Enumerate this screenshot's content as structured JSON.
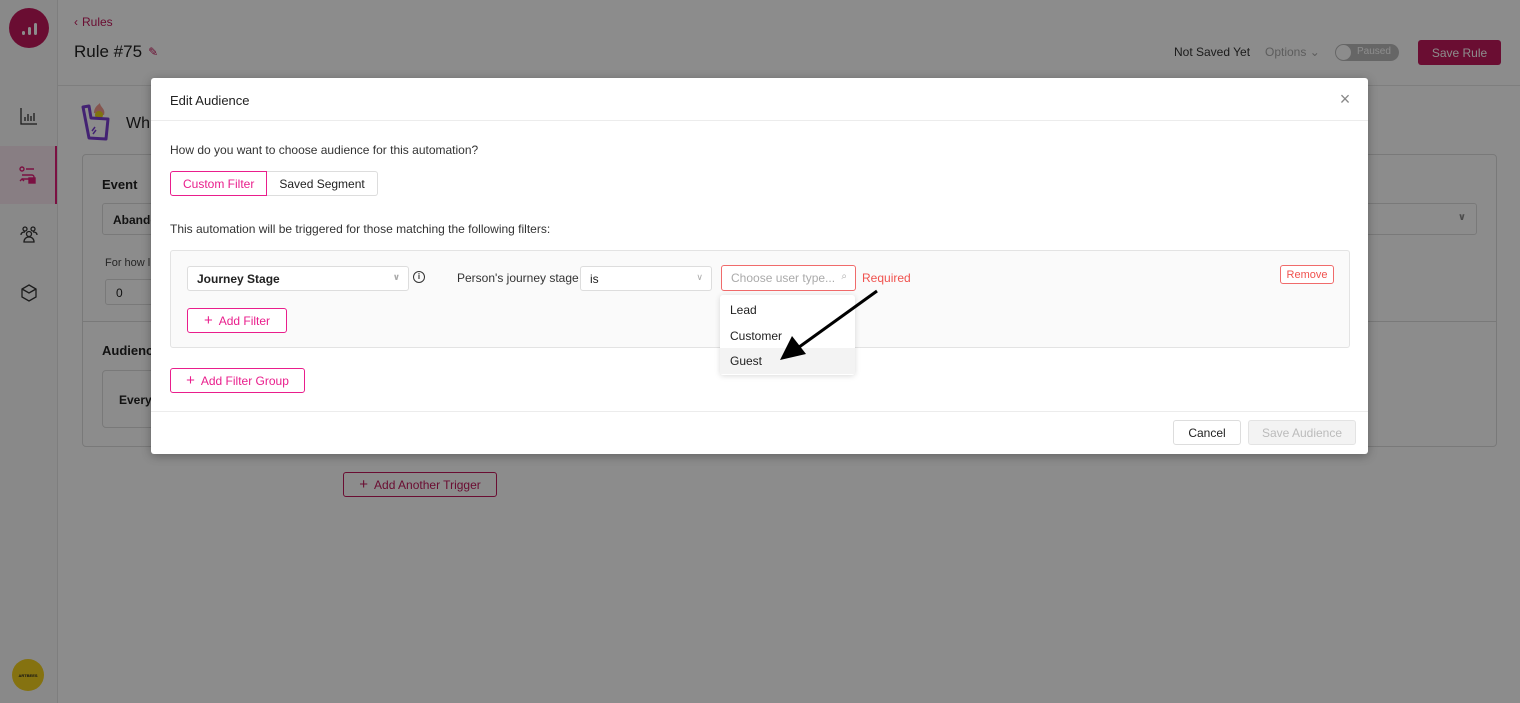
{
  "app": {
    "nav": [
      {
        "icon": "bar-chart-icon",
        "active": false
      },
      {
        "icon": "workflow-rules-icon",
        "active": true
      },
      {
        "icon": "users-icon",
        "active": false
      },
      {
        "icon": "cube-icon",
        "active": false
      }
    ],
    "brand_avatar_text": "ARTBEES"
  },
  "topbar": {
    "back_label": "Rules",
    "title": "Rule #75",
    "save_status": "Not Saved Yet",
    "options_label": "Options",
    "toggle_label": "Paused",
    "save_rule_label": "Save Rule"
  },
  "background": {
    "section_title_partial": "Wh",
    "event_label": "Event",
    "event_value_partial": "Abando",
    "duration_label_partial": "For how l",
    "duration_value": "0",
    "audience_label_partial": "Audienc",
    "audience_value_partial": "Everyo",
    "add_trigger_label": "Add Another Trigger"
  },
  "modal": {
    "title": "Edit Audience",
    "question": "How do you want to choose audience for this automation?",
    "tabs": [
      {
        "label": "Custom Filter",
        "active": true
      },
      {
        "label": "Saved Segment",
        "active": false
      }
    ],
    "trigger_text": "This automation will be triggered for those matching the following filters:",
    "filter": {
      "property": "Journey Stage",
      "property_label": "Person's journey stage",
      "operator": "is",
      "value_placeholder": "Choose user type...",
      "validation": "Required",
      "remove_label": "Remove"
    },
    "add_filter_label": "Add Filter",
    "add_filter_group_label": "Add Filter Group",
    "dropdown_options": [
      "Lead",
      "Customer",
      "Guest"
    ],
    "hovered_option": "Guest",
    "cancel_label": "Cancel",
    "save_label": "Save Audience"
  },
  "colors": {
    "brand": "#c2185b",
    "accent_pink": "#e91e8c",
    "error_red": "#f0524e"
  }
}
